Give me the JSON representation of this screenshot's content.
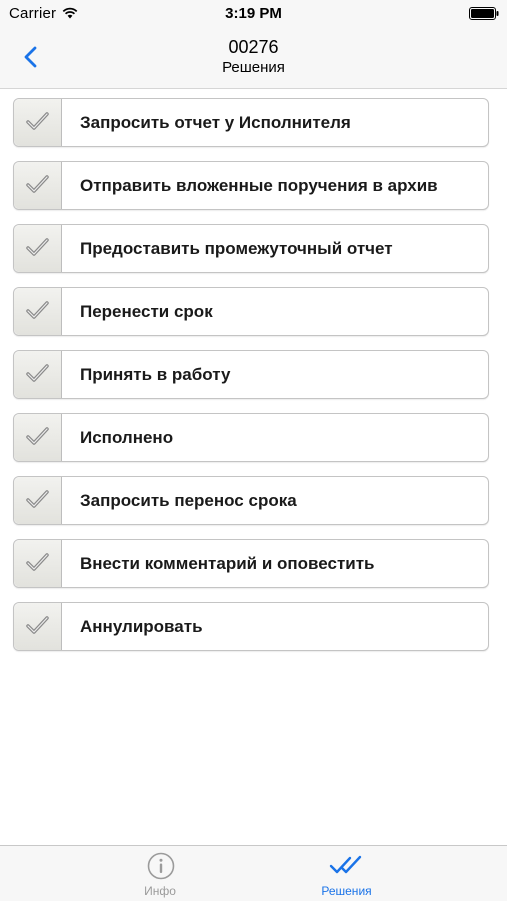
{
  "status_bar": {
    "carrier": "Carrier",
    "time": "3:19 PM"
  },
  "nav": {
    "title": "00276",
    "subtitle": "Решения",
    "accent_color": "#1a73e8"
  },
  "actions": [
    {
      "label": "Запросить отчет у Исполнителя",
      "icon": "checkmark-icon"
    },
    {
      "label": "Отправить вложенные поручения в архив",
      "icon": "checkmark-icon"
    },
    {
      "label": "Предоставить промежуточный отчет",
      "icon": "checkmark-icon"
    },
    {
      "label": "Перенести срок",
      "icon": "checkmark-icon"
    },
    {
      "label": "Принять в работу",
      "icon": "checkmark-icon"
    },
    {
      "label": "Исполнено",
      "icon": "checkmark-icon"
    },
    {
      "label": "Запросить перенос срока",
      "icon": "checkmark-icon"
    },
    {
      "label": "Внести комментарий и оповестить",
      "icon": "checkmark-icon"
    },
    {
      "label": "Аннулировать",
      "icon": "checkmark-icon"
    }
  ],
  "tab_bar": {
    "tabs": [
      {
        "label": "Инфо",
        "icon": "info-icon",
        "selected": false,
        "color": "#9b9b9b"
      },
      {
        "label": "Решения",
        "icon": "double-check-icon",
        "selected": true,
        "color": "#1a73e8"
      }
    ]
  }
}
